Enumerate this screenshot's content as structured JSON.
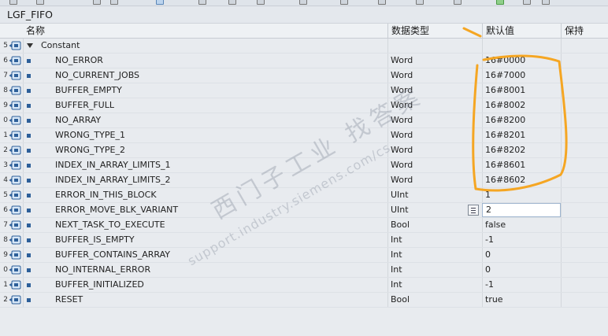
{
  "window": {
    "title": "LGF_FIFO"
  },
  "toolbar": {
    "icons": [
      "toolbar-icon",
      "toolbar-icon",
      "toolbar-icon",
      "toolbar-icon",
      "toolbar-icon"
    ]
  },
  "table": {
    "headers": {
      "name": "名称",
      "type": "数据类型",
      "default": "默认值",
      "retain": "保持"
    },
    "section": {
      "row": "5",
      "name": "Constant"
    },
    "rows": [
      {
        "row": "6",
        "name": "NO_ERROR",
        "type": "Word",
        "default": "16#0000"
      },
      {
        "row": "7",
        "name": "NO_CURRENT_JOBS",
        "type": "Word",
        "default": "16#7000"
      },
      {
        "row": "8",
        "name": "BUFFER_EMPTY",
        "type": "Word",
        "default": "16#8001"
      },
      {
        "row": "9",
        "name": "BUFFER_FULL",
        "type": "Word",
        "default": "16#8002"
      },
      {
        "row": "0",
        "name": "NO_ARRAY",
        "type": "Word",
        "default": "16#8200"
      },
      {
        "row": "1",
        "name": "WRONG_TYPE_1",
        "type": "Word",
        "default": "16#8201"
      },
      {
        "row": "2",
        "name": "WRONG_TYPE_2",
        "type": "Word",
        "default": "16#8202"
      },
      {
        "row": "3",
        "name": "INDEX_IN_ARRAY_LIMITS_1",
        "type": "Word",
        "default": "16#8601"
      },
      {
        "row": "4",
        "name": "INDEX_IN_ARRAY_LIMITS_2",
        "type": "Word",
        "default": "16#8602"
      },
      {
        "row": "5",
        "name": "ERROR_IN_THIS_BLOCK",
        "type": "UInt",
        "default": "1"
      },
      {
        "row": "6",
        "name": "ERROR_MOVE_BLK_VARIANT",
        "type": "UInt",
        "default": "2"
      },
      {
        "row": "7",
        "name": "NEXT_TASK_TO_EXECUTE",
        "type": "Bool",
        "default": "false"
      },
      {
        "row": "8",
        "name": "BUFFER_IS_EMPTY",
        "type": "Int",
        "default": "-1"
      },
      {
        "row": "9",
        "name": "BUFFER_CONTAINS_ARRAY",
        "type": "Int",
        "default": "0"
      },
      {
        "row": "0",
        "name": "NO_INTERNAL_ERROR",
        "type": "Int",
        "default": "0"
      },
      {
        "row": "1",
        "name": "BUFFER_INITIALIZED",
        "type": "Int",
        "default": "-1"
      },
      {
        "row": "2",
        "name": "RESET",
        "type": "Bool",
        "default": "true"
      }
    ]
  },
  "watermark": {
    "line1": "西门子工业 找答案",
    "line2": "support.industry.siemens.com/cs"
  },
  "colors": {
    "annotation": "#f5a623",
    "interface_icon": "#2d5f99",
    "edit_border": "#9fb5cf"
  }
}
